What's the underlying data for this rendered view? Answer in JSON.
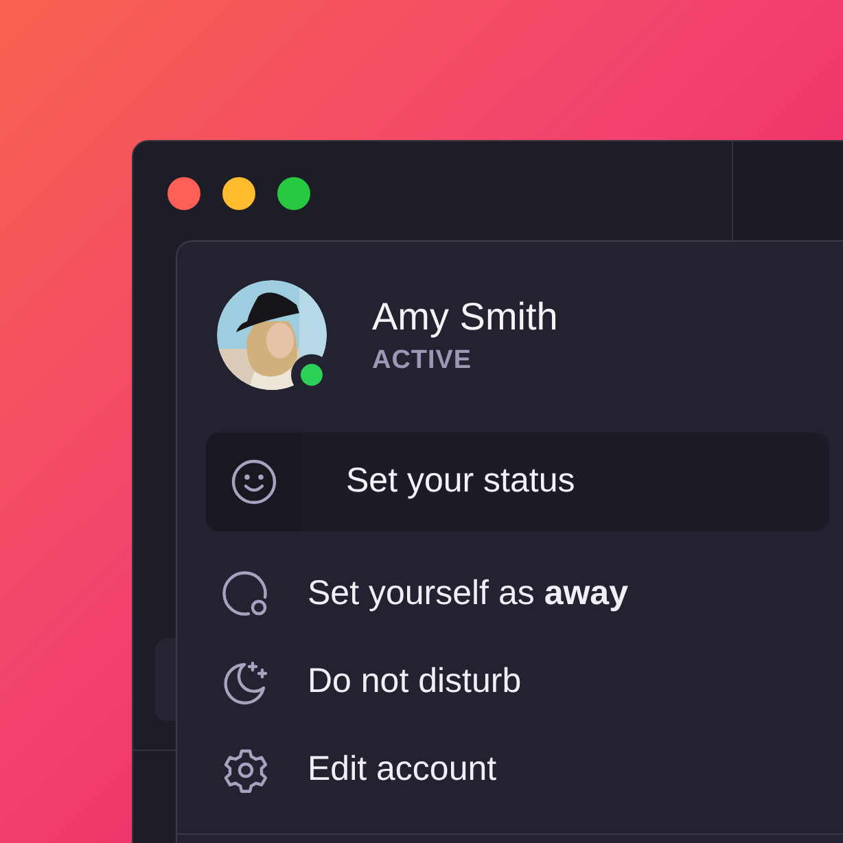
{
  "user": {
    "name": "Amy Smith",
    "status": "ACTIVE",
    "online": true
  },
  "status_button": {
    "label": "Set your status"
  },
  "menu": [
    {
      "label": "Set yourself as **away**"
    },
    {
      "label": "Do not disturb"
    },
    {
      "label": "Edit account"
    }
  ]
}
